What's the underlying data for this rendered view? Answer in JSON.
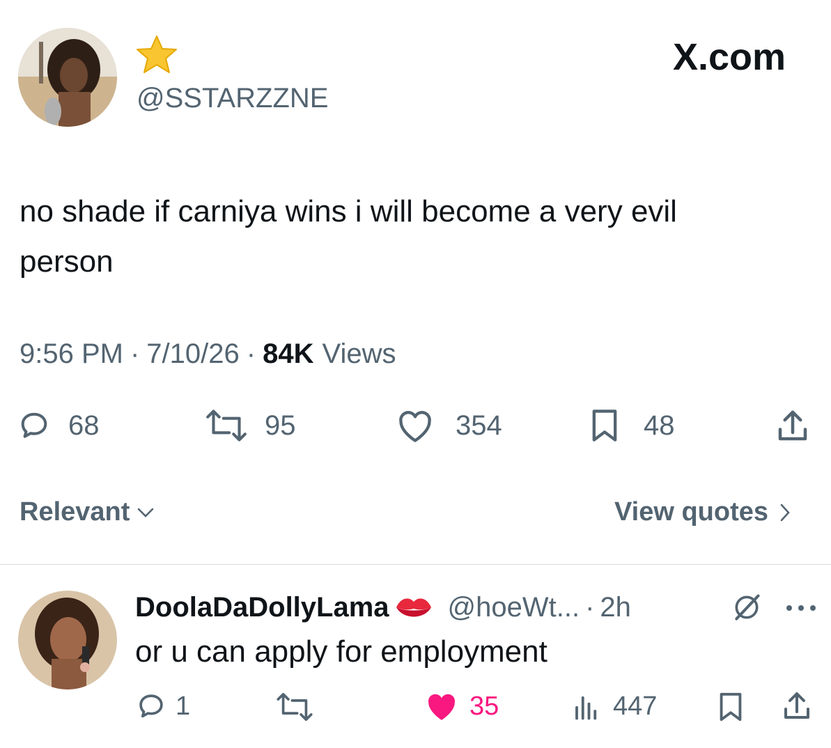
{
  "header": {
    "display_name_emoji": "star",
    "handle": "@SSTARZZNE",
    "brand": "X.com",
    "avatar_icon": "profile-photo"
  },
  "tweet": {
    "text_line1": "no shade if carniya wins i will become a very evil",
    "text_line2": "person",
    "time": "9:56 PM",
    "sep1": "·",
    "date": "7/10/26",
    "sep2": "·",
    "views_count": "84K",
    "views_label": "Views",
    "actions": {
      "replies": "68",
      "reposts": "95",
      "likes": "354",
      "bookmarks": "48"
    }
  },
  "filters": {
    "relevant_label": "Relevant",
    "view_quotes_label": "View quotes"
  },
  "reply": {
    "display_name": "DoolaDaDollyLama",
    "name_emoji": "kiss-mark",
    "handle": "@hoeWt...",
    "sep": "·",
    "age": "2h",
    "text": "or u can apply for employment",
    "actions": {
      "replies": "1",
      "reposts": "",
      "likes": "35",
      "views": "447"
    }
  },
  "colors": {
    "text": "#0f1419",
    "secondary": "#536471",
    "like_pink": "#f91880",
    "divider": "#d9dde1"
  }
}
